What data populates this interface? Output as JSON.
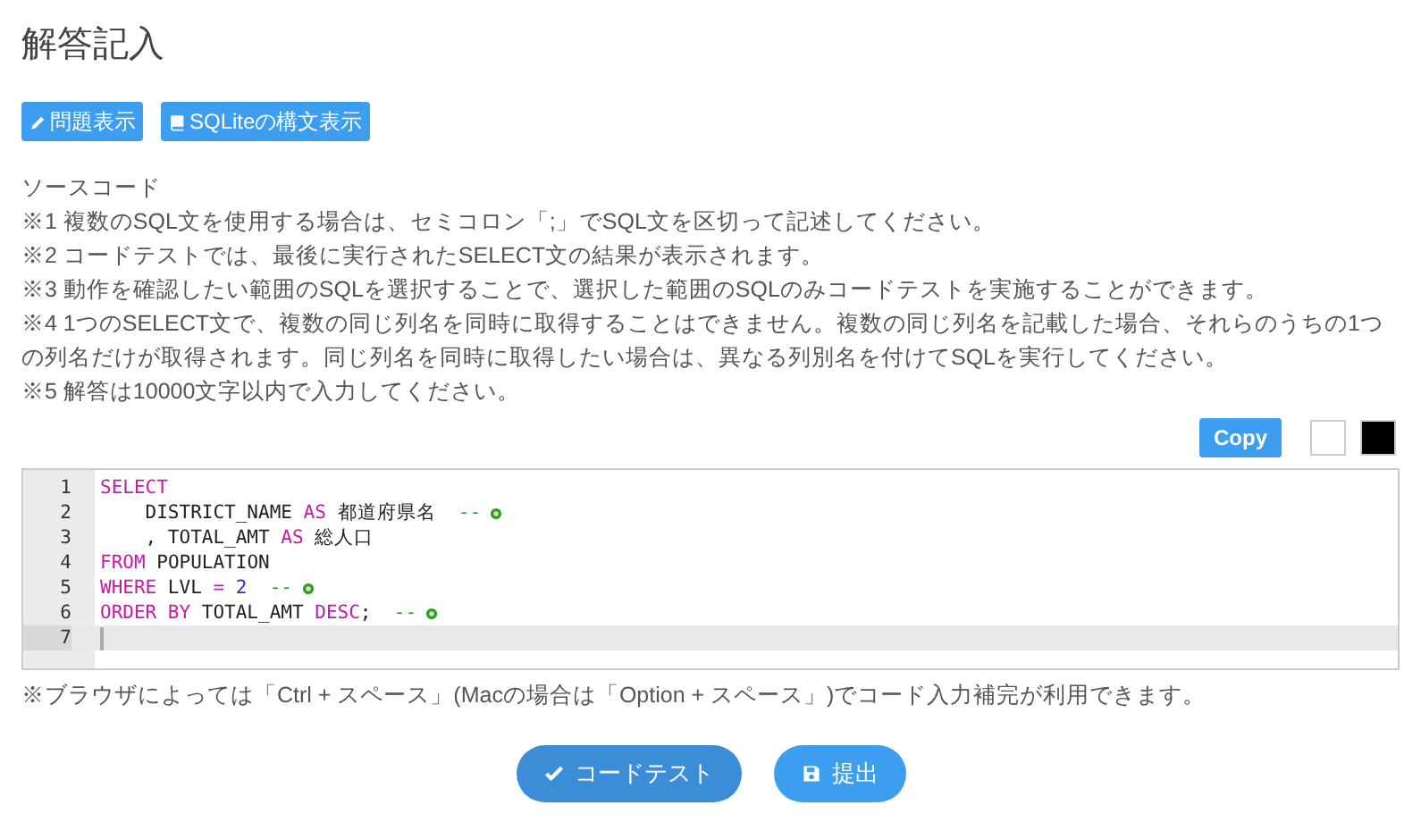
{
  "title": "解答記入",
  "tool_buttons": [
    {
      "label": "問題表示",
      "kind": "pencil"
    },
    {
      "label": "SQLiteの構文表示",
      "kind": "book"
    }
  ],
  "notes": [
    "ソースコード",
    "※1 複数のSQL文を使用する場合は、セミコロン「;」でSQL文を区切って記述してください。",
    "※2 コードテストでは、最後に実行されたSELECT文の結果が表示されます。",
    "※3 動作を確認したい範囲のSQLを選択することで、選択した範囲のSQLのみコードテストを実施することができます。",
    "※4 1つのSELECT文で、複数の同じ列名を同時に取得することはできません。複数の同じ列名を記載した場合、それらのうちの1つの列名だけが取得されます。同じ列名を同時に取得したい場合は、異なる列別名を付けてSQLを実行してください。",
    "※5 解答は10000文字以内で入力してください。"
  ],
  "copy_button": "Copy",
  "editor": {
    "lines": [
      {
        "number": "1",
        "active": false,
        "tokens": [
          {
            "kind": "keyword",
            "text": "SELECT"
          }
        ]
      },
      {
        "number": "2",
        "active": false,
        "tokens": [
          {
            "kind": "plain",
            "text": "    DISTRICT_NAME "
          },
          {
            "kind": "keyword",
            "text": "AS"
          },
          {
            "kind": "plain",
            "text": " 都道府県名  "
          },
          {
            "kind": "comment",
            "text": "--"
          }
        ]
      },
      {
        "number": "3",
        "active": false,
        "tokens": [
          {
            "kind": "plain",
            "text": "    , TOTAL_AMT "
          },
          {
            "kind": "keyword",
            "text": "AS"
          },
          {
            "kind": "plain",
            "text": " 総人口"
          }
        ]
      },
      {
        "number": "4",
        "active": false,
        "tokens": [
          {
            "kind": "keyword",
            "text": "FROM"
          },
          {
            "kind": "plain",
            "text": " POPULATION"
          }
        ]
      },
      {
        "number": "5",
        "active": false,
        "tokens": [
          {
            "kind": "keyword",
            "text": "WHERE"
          },
          {
            "kind": "plain",
            "text": " LVL "
          },
          {
            "kind": "keyword",
            "text": "="
          },
          {
            "kind": "number",
            "text": " 2"
          },
          {
            "kind": "comment",
            "text": "  --"
          }
        ]
      },
      {
        "number": "6",
        "active": false,
        "tokens": [
          {
            "kind": "keyword",
            "text": "ORDER BY"
          },
          {
            "kind": "plain",
            "text": " TOTAL_AMT "
          },
          {
            "kind": "keyword",
            "text": "DESC"
          },
          {
            "kind": "plain",
            "text": ";  "
          },
          {
            "kind": "comment",
            "text": "--"
          }
        ]
      },
      {
        "number": "7",
        "active": true
      }
    ]
  },
  "hint": "※ブラウザによっては「Ctrl + スペース」(Macの場合は「Option + スペース」)でコード入力補完が利用できます。",
  "action_buttons": [
    {
      "label": "コードテスト",
      "kind": "check"
    },
    {
      "label": "提出",
      "kind": "save"
    }
  ]
}
